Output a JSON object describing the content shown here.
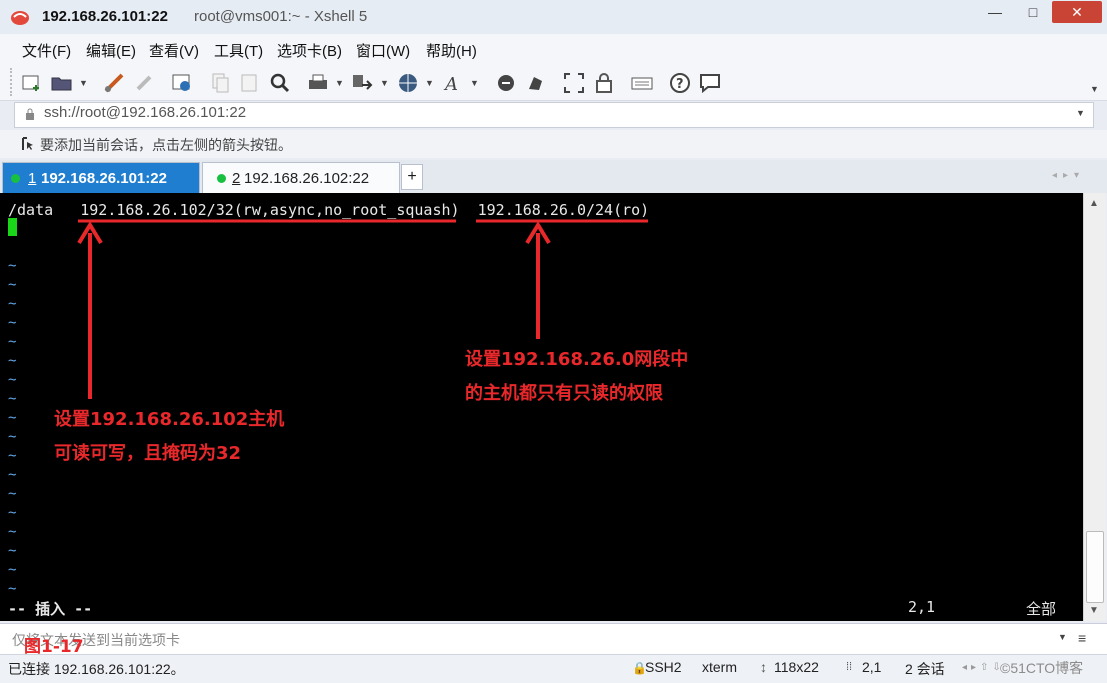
{
  "window": {
    "title_host": "192.168.26.101:22",
    "title_rest": "root@vms001:~ - Xshell 5",
    "minimize": "—",
    "maximize": "□",
    "close": "✕"
  },
  "menu": [
    "文件(F)",
    "编辑(E)",
    "查看(V)",
    "工具(T)",
    "选项卡(B)",
    "窗口(W)",
    "帮助(H)"
  ],
  "toolbar_icons": [
    "new-session-icon",
    "open-folder-icon",
    "connect-icon",
    "disconnect-icon",
    "properties-icon",
    "copy-icon",
    "paste-icon",
    "find-icon",
    "print-icon",
    "transfer-icon",
    "globe-icon",
    "font-icon",
    "xftp-icon",
    "xmanager-icon",
    "fullscreen-icon",
    "lock-icon",
    "keyboard-icon",
    "help-icon",
    "chat-icon"
  ],
  "address": {
    "value": "ssh://root@192.168.26.101:22"
  },
  "hint": {
    "text": "要添加当前会话，点击左侧的箭头按钮。"
  },
  "tabs": [
    {
      "num": "1",
      "label": "192.168.26.101:22",
      "active": true,
      "dot_color": "#18c040"
    },
    {
      "num": "2",
      "label": "192.168.26.102:22",
      "active": false,
      "dot_color": "#18c040"
    }
  ],
  "tab_add": "+",
  "tab_nav": "◂▸▾",
  "terminal": {
    "line1_path": "/data",
    "line1_rule1": "192.168.26.102/32(rw,async,no_root_squash)",
    "line1_rule2": "192.168.26.0/24(ro)",
    "tilde": "~",
    "mode": "-- 插入 --",
    "position": "2,1",
    "scope": "全部"
  },
  "annotations": {
    "left_line1": "设置192.168.26.102主机",
    "left_line2": "可读可写，且掩码为32",
    "right_line1": "设置192.168.26.0网段中",
    "right_line2": "的主机都只有只读的权限",
    "color": "#e8282b"
  },
  "compose": {
    "placeholder": "仅将文本发送到当前选项卡",
    "figure_label": "图1-17"
  },
  "status": {
    "connection": "已连接 192.168.26.101:22。",
    "protocol": "SSH2",
    "terminal_type": "xterm",
    "size": "118x22",
    "cursor": "2,1",
    "sessions": "2 会话",
    "watermark": "©51CTO博客"
  }
}
